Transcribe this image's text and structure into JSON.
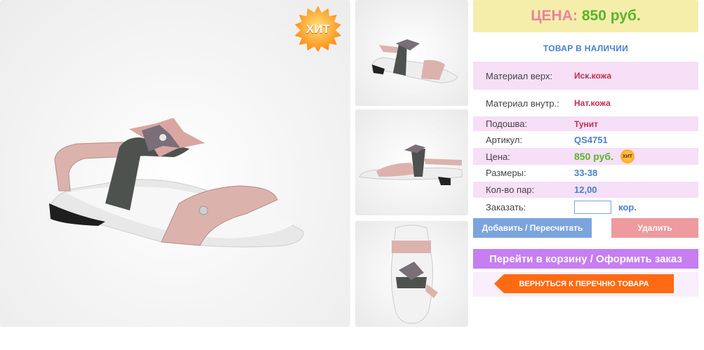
{
  "badge": {
    "hit_label": "ХИТ",
    "mini_hit_label": "ХИТ"
  },
  "price_box": {
    "label": "ЦЕНА:",
    "value": "850 руб."
  },
  "stock_status": "ТОВАР В НАЛИЧИИ",
  "specs": [
    {
      "label": "Материал верх:",
      "value": "Иск.кожа"
    },
    {
      "label": "Материал внутр.:",
      "value": "Нат.кожа"
    },
    {
      "label": "Подошва:",
      "value": "Тунит"
    },
    {
      "label": "Артикул:",
      "value": "QS4751"
    },
    {
      "label": "Цена:",
      "value": "850 руб."
    },
    {
      "label": "Размеры:",
      "value": "33-38"
    },
    {
      "label": "Кол-во пар:",
      "value": "12,00"
    }
  ],
  "order": {
    "label": "Заказать:",
    "input_value": "",
    "unit": "кор."
  },
  "buttons": {
    "add": "Добавить / Пересчитать",
    "delete": "Удалить",
    "cart": "Перейти в корзину / Оформить заказ",
    "back": "ВЕРНУТЬСЯ К ПЕРЕЧНЮ ТОВАРА"
  },
  "colors": {
    "accent_blue": "#4a80c8",
    "price_green": "#5ab52c",
    "value_red": "#c0304e",
    "row_pink": "#f6dff7",
    "cart_purple": "#c77ef0",
    "back_orange": "#ff6a12"
  },
  "images": {
    "main": "sandal-side-view",
    "thumbs": [
      "sandal-angle-view",
      "sandal-side-view",
      "sandal-top-view"
    ]
  }
}
